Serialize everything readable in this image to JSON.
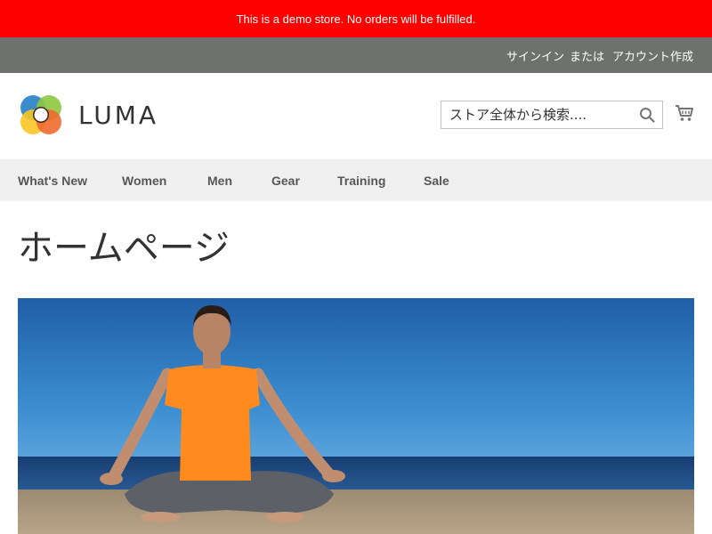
{
  "demo_notice": "This is a demo store. No orders will be fulfilled.",
  "header": {
    "sign_in": "サインイン",
    "separator": "または",
    "create_account": "アカウント作成",
    "logo_text": "LUMA",
    "search_placeholder": "ストア全体から検索...."
  },
  "nav": {
    "items": [
      "What's New",
      "Women",
      "Men",
      "Gear",
      "Training",
      "Sale"
    ]
  },
  "page": {
    "title": "ホームページ"
  },
  "colors": {
    "demo_bar": "#ff0000",
    "top_bar": "#6e716e",
    "nav_bg": "#f0f0f0"
  },
  "icons": [
    "luma-logo-icon",
    "search-icon",
    "cart-icon"
  ]
}
